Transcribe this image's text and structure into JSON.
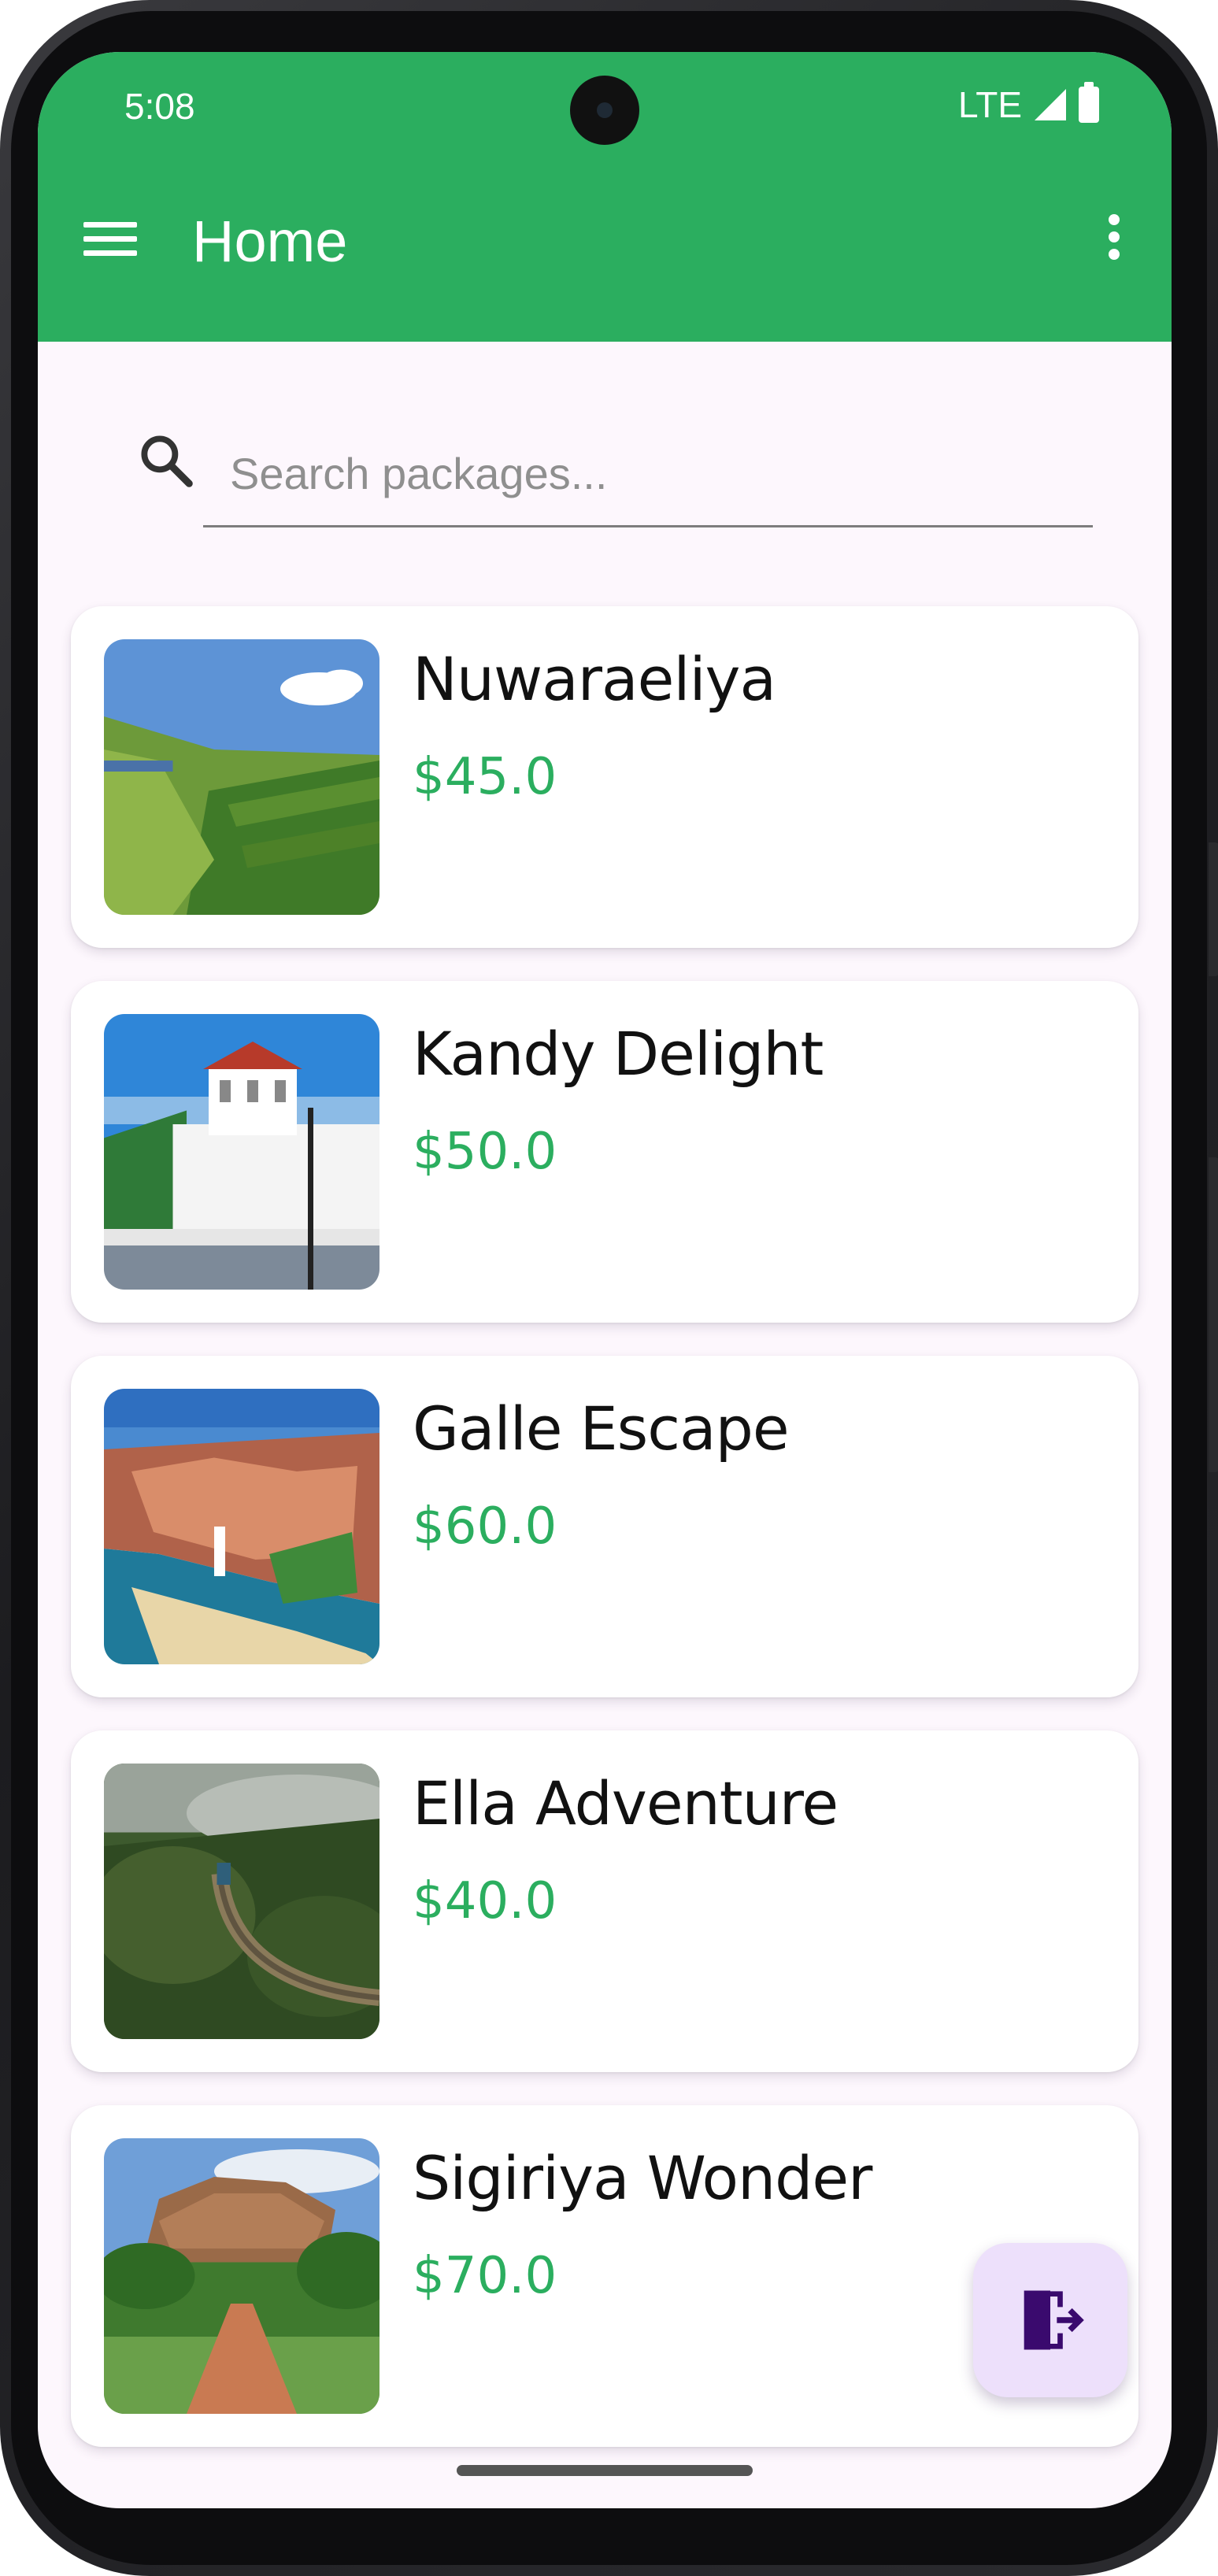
{
  "status_bar": {
    "time": "5:08",
    "network": "LTE"
  },
  "app_bar": {
    "title": "Home"
  },
  "search": {
    "placeholder": "Search packages...",
    "value": ""
  },
  "packages": [
    {
      "name": "Nuwaraeliya",
      "price": "$45.0"
    },
    {
      "name": "Kandy Delight",
      "price": "$50.0"
    },
    {
      "name": "Galle Escape",
      "price": "$60.0"
    },
    {
      "name": "Ella Adventure",
      "price": "$40.0"
    },
    {
      "name": "Sigiriya Wonder",
      "price": "$70.0"
    }
  ],
  "icons": {
    "menu": "menu-icon",
    "overflow": "more-vert-icon",
    "search": "search-icon",
    "fab": "logout-icon"
  },
  "colors": {
    "primary": "#2bae5f",
    "background": "#fdf7fd",
    "fab_background": "#ede0fb",
    "fab_icon": "#3a0a6e"
  }
}
